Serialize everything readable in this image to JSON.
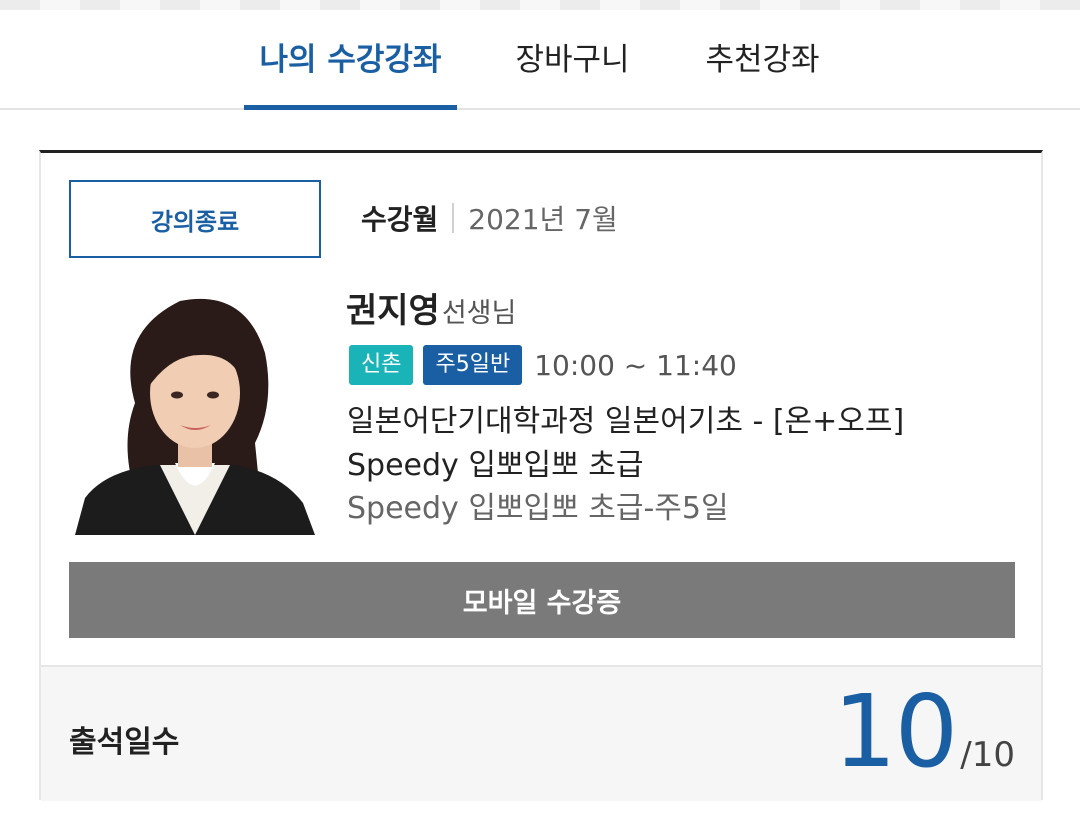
{
  "tabs": [
    {
      "label": "나의 수강강좌",
      "active": true
    },
    {
      "label": "장바구니",
      "active": false
    },
    {
      "label": "추천강좌",
      "active": false
    }
  ],
  "card": {
    "status": "강의종료",
    "month_label": "수강월",
    "month_value": "2021년 7월",
    "teacher_name": "권지영",
    "teacher_suffix": "선생님",
    "tags": {
      "location": "신촌",
      "schedule": "주5일반"
    },
    "time": "10:00 ~ 11:40",
    "course_title": "일본어단기대학과정 일본어기초 - [온+오프] Speedy 입뽀입뽀 초급",
    "course_subtitle": "Speedy 입뽀입뽀 초급-주5일",
    "mobile_button": "모바일 수강증",
    "attendance": {
      "label": "출석일수",
      "count": "10",
      "total": "/10"
    }
  },
  "colors": {
    "accent": "#1a5fa3",
    "teal": "#1ab3b8",
    "button_gray": "#7a7a7a"
  }
}
